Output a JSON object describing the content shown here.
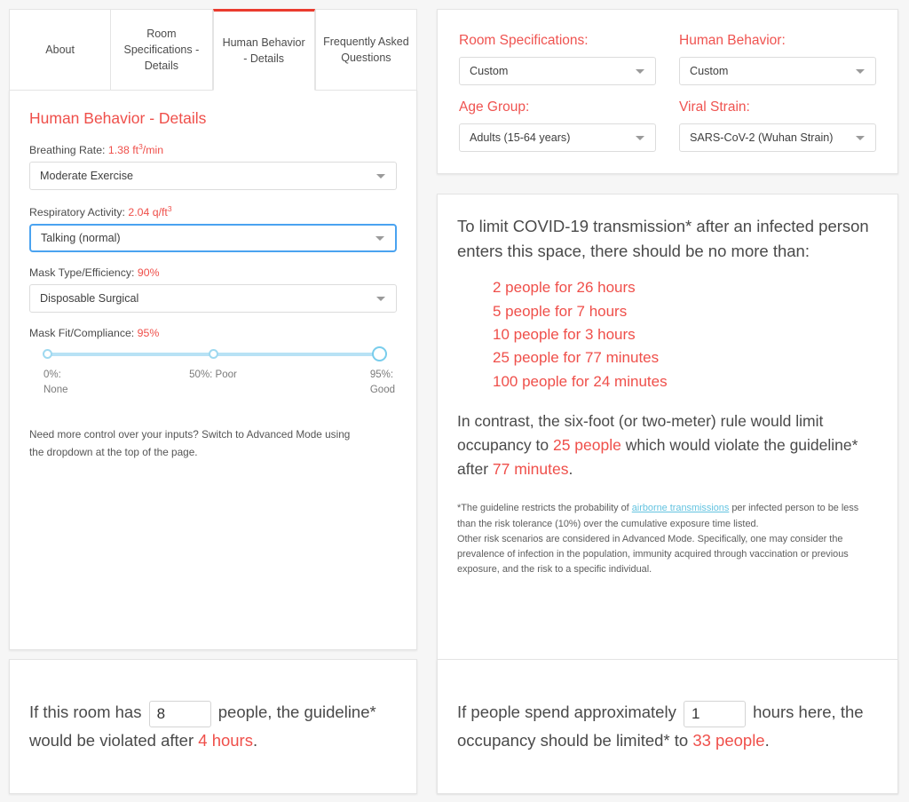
{
  "tabs": [
    {
      "label": "About",
      "active": false
    },
    {
      "label": "Room Specifications - Details",
      "active": false
    },
    {
      "label": "Human Behavior - Details",
      "active": true
    },
    {
      "label": "Frequently Asked Questions",
      "active": false
    }
  ],
  "left_panel": {
    "section_title": "Human Behavior - Details",
    "fields": [
      {
        "label_text": "Breathing Rate: ",
        "label_value": "1.38 ft",
        "label_value_sup": "3",
        "label_value_tail": "/min",
        "selected": "Moderate Exercise",
        "focused": false
      },
      {
        "label_text": "Respiratory Activity: ",
        "label_value": "2.04 q/ft",
        "label_value_sup": "3",
        "label_value_tail": "",
        "selected": "Talking (normal)",
        "focused": true
      },
      {
        "label_text": "Mask Type/Efficiency: ",
        "label_value": "90%",
        "label_value_sup": "",
        "label_value_tail": "",
        "selected": "Disposable Surgical",
        "focused": false
      }
    ],
    "slider": {
      "label_text": "Mask Fit/Compliance: ",
      "label_value": "95%",
      "value_percent": 100,
      "ticks": [
        0,
        50
      ],
      "labels": {
        "left": "0%:\nNone",
        "mid": "50%: Poor",
        "right": "95%:\nGood"
      }
    },
    "hint": "Need more control over your inputs? Switch to Advanced Mode using the dropdown at the top of the page."
  },
  "settings_panel": {
    "groups": [
      {
        "label": "Room Specifications:",
        "selected": "Custom"
      },
      {
        "label": "Human Behavior:",
        "selected": "Custom"
      },
      {
        "label": "Age Group:",
        "selected": "Adults (15-64 years)"
      },
      {
        "label": "Viral Strain:",
        "selected": "SARS-CoV-2 (Wuhan Strain)"
      }
    ]
  },
  "results_panel": {
    "lead": "To limit COVID-19 transmission* after an infected person enters this space, there should be no more than:",
    "limits": [
      "2 people for 26 hours",
      "5 people for 7 hours",
      "10 people for 3 hours",
      "25 people for 77 minutes",
      "100 people for 24 minutes"
    ],
    "contrast": {
      "part1": "In contrast, the six-foot (or two-meter) rule would limit occupancy to ",
      "highlight1": "25 people",
      "part2": " which would violate the guideline* after ",
      "highlight2": "77 minutes",
      "part3": "."
    },
    "footnote": {
      "line1_pre": "*The guideline restricts the probability of ",
      "link": "airborne transmissions",
      "line1_post": " per infected person to be less than the risk tolerance (10%) over the cumulative exposure time listed.",
      "line2": "Other risk scenarios are considered in Advanced Mode. Specifically, one may consider the prevalence of infection in the population, immunity acquired through vaccination or previous exposure, and the risk to a specific individual."
    }
  },
  "bottom_left": {
    "pre": "If this room has",
    "input_value": "8",
    "mid": "people, the guideline* would be violated after ",
    "highlight": "4 hours",
    "post": "."
  },
  "bottom_right": {
    "pre": "If people spend approximately",
    "input_value": "1",
    "mid": "hours here, the occupancy should be limited* to ",
    "highlight": "33 people",
    "post": "."
  },
  "colors": {
    "accent_red": "#ef4f4a",
    "tab_active_red": "#ea3b2e",
    "link_blue": "#63c3e0",
    "focus_blue": "#4aa3f0",
    "slider_track": "#b8e2f5",
    "page_bg": "#f6f6f6"
  }
}
